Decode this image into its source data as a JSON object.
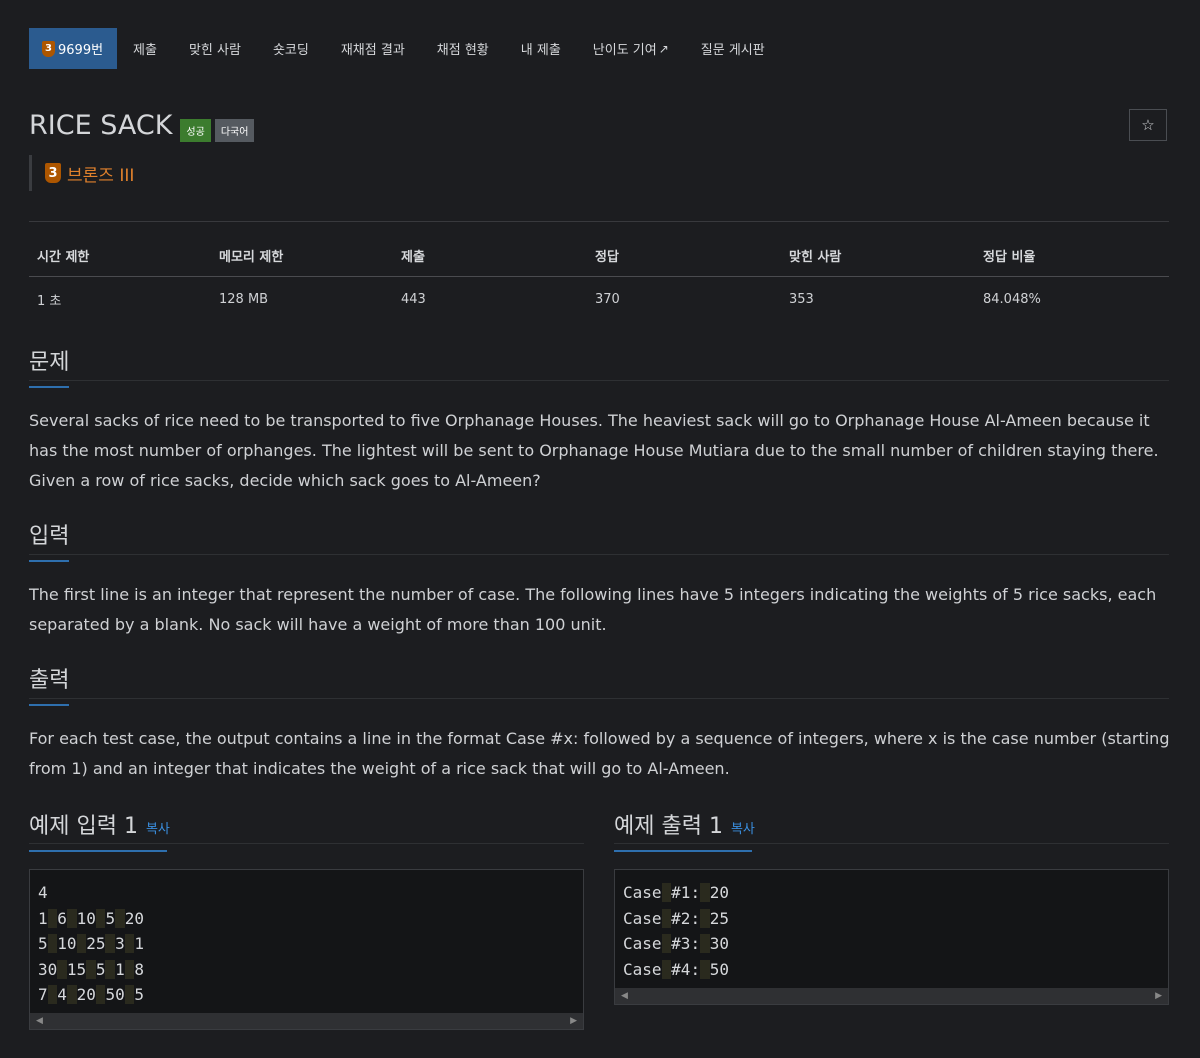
{
  "tabs": {
    "problem_tier": "3",
    "problem_number": "9699번",
    "submit": "제출",
    "solvers": "맞힌 사람",
    "shortcoding": "숏코딩",
    "rejudge": "재채점 결과",
    "status": "채점 현황",
    "my_submissions": "내 제출",
    "difficulty": "난이도 기여",
    "board": "질문 게시판"
  },
  "problem": {
    "title": "RICE SACK",
    "label_success": "성공",
    "label_multilang": "다국어",
    "tier_number": "3",
    "tier_name": "브론즈 III"
  },
  "info_table": {
    "headers": [
      "시간 제한",
      "메모리 제한",
      "제출",
      "정답",
      "맞힌 사람",
      "정답 비율"
    ],
    "values": [
      "1 초",
      "128 MB",
      "443",
      "370",
      "353",
      "84.048%"
    ]
  },
  "sections": {
    "description_title": "문제",
    "description": "Several sacks of rice need to be transported to five Orphanage Houses. The heaviest sack will go to Orphanage House Al-Ameen because it has the most number of orphanges. The lightest will be sent to Orphanage House Mutiara due to the small number of children staying there. Given a row of rice sacks, decide which sack goes to Al-Ameen?",
    "input_title": "입력",
    "input": "The first line is an integer that represent the number of case. The following lines have 5 integers indicating the weights of 5 rice sacks, each separated by a blank. No sack will have a weight of more than 100 unit.",
    "output_title": "출력",
    "output": "For each test case, the output contains a line in the format Case #x: followed by a sequence of integers, where x is the case number (starting from 1) and an integer that indicates the weight of a rice sack that will go to Al-Ameen."
  },
  "samples": {
    "input_title": "예제 입력 1",
    "output_title": "예제 출력 1",
    "copy_label": "복사",
    "input_lines": [
      [
        "4"
      ],
      [
        "1",
        "6",
        "10",
        "5",
        "20"
      ],
      [
        "5",
        "10",
        "25",
        "3",
        "1"
      ],
      [
        "30",
        "15",
        "5",
        "1",
        "8"
      ],
      [
        "7",
        "4",
        "20",
        "50",
        "5"
      ]
    ],
    "output_lines": [
      [
        "Case",
        "#1:",
        "20"
      ],
      [
        "Case",
        "#2:",
        "25"
      ],
      [
        "Case",
        "#3:",
        "30"
      ],
      [
        "Case",
        "#4:",
        "50"
      ]
    ]
  },
  "colors": {
    "active_tab": "#2b5b8f",
    "bronze": "#ad5600",
    "tier_text": "#e0812c",
    "success": "#3c7c2e",
    "link": "#3a8ede"
  }
}
